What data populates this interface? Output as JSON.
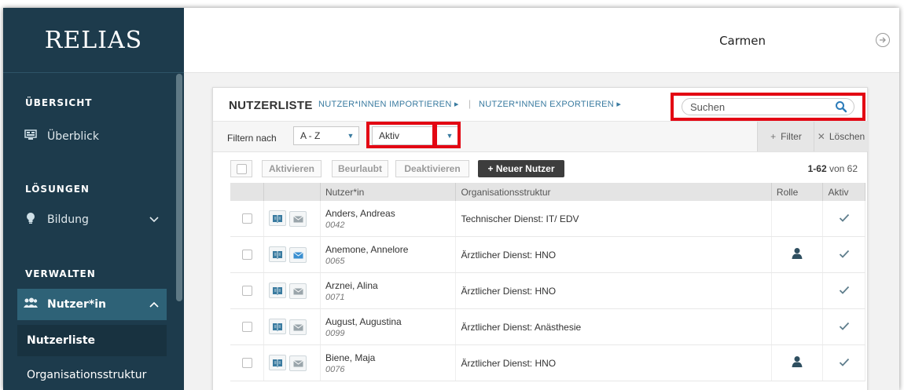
{
  "brand": {
    "logo_text": "RELIAS"
  },
  "sidebar": {
    "sections": {
      "overview": "ÜBERSICHT",
      "solutions": "LÖSUNGEN",
      "manage": "VERWALTEN"
    },
    "items": {
      "overview": "Überblick",
      "education": "Bildung",
      "users": "Nutzer*in",
      "user_list": "Nutzerliste",
      "org_structure": "Organisationsstruktur"
    }
  },
  "header": {
    "username": "Carmen"
  },
  "panel": {
    "title": "NUTZERLISTE",
    "import_link": "NUTZER*INNEN IMPORTIEREN ▸",
    "separator": "|",
    "export_link": "NUTZER*INNEN EXPORTIEREN ▸",
    "search_placeholder": "Suchen"
  },
  "filters": {
    "label": "Filtern nach",
    "sort_value": "A - Z",
    "status_value": "Aktiv",
    "filter_button": "Filter",
    "clear_button": "Löschen"
  },
  "actions": {
    "activate": "Aktivieren",
    "leave": "Beurlaubt",
    "deactivate": "Deaktivieren",
    "new_user": "+ Neuer Nutzer",
    "range": "1-62",
    "of_total": "von 62"
  },
  "table": {
    "columns": [
      "",
      "",
      "Nutzer*in",
      "Organisationsstruktur",
      "Rolle",
      "Aktiv"
    ],
    "rows": [
      {
        "name": "Anders, Andreas",
        "id": "0042",
        "org": "Technischer Dienst: IT/ EDV",
        "role": false,
        "active": true
      },
      {
        "name": "Anemone, Annelore",
        "id": "0065",
        "org": "Ärztlicher Dienst: HNO",
        "role": true,
        "active": true
      },
      {
        "name": "Arznei, Alina",
        "id": "0071",
        "org": "Ärztlicher Dienst: HNO",
        "role": false,
        "active": true
      },
      {
        "name": "August, Augustina",
        "id": "0099",
        "org": "Ärztlicher Dienst: Anästhesie",
        "role": false,
        "active": true
      },
      {
        "name": "Biene, Maja",
        "id": "0076",
        "org": "Ärztlicher Dienst: HNO",
        "role": true,
        "active": true
      }
    ]
  },
  "colors": {
    "sidebar_bg": "#1d3b4c",
    "highlight_red": "#e30613",
    "link_blue": "#3a7ba0"
  },
  "icons": [
    "monitor-icon",
    "lightbulb-icon",
    "users-icon",
    "chevron-down-icon",
    "chevron-up-icon",
    "logout-icon",
    "search-icon",
    "book-icon",
    "mail-icon",
    "plus-icon",
    "close-icon",
    "person-icon",
    "checkmark-icon"
  ]
}
